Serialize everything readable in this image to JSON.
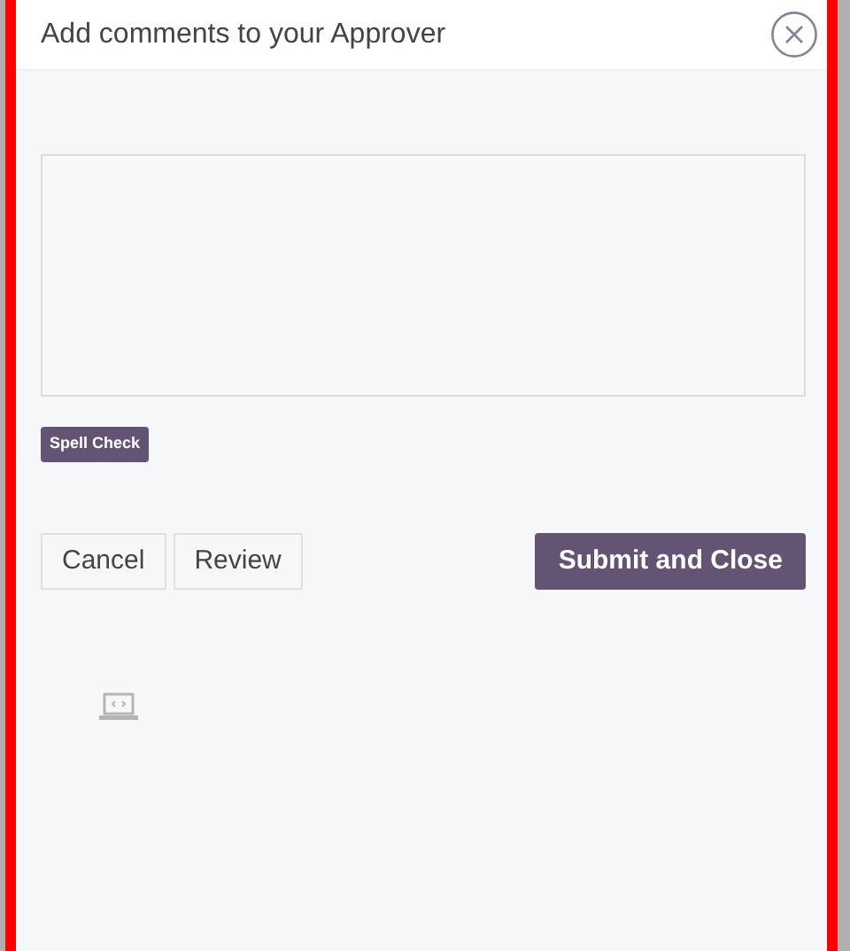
{
  "dialog": {
    "title": "Add comments to your Approver"
  },
  "spell_check": {
    "label": "Spell Check"
  },
  "buttons": [
    {
      "label": "Cancel",
      "kind": "secondary"
    },
    {
      "label": "Review",
      "kind": "secondary"
    },
    {
      "label": "Submit and Close",
      "kind": "primary"
    }
  ]
}
